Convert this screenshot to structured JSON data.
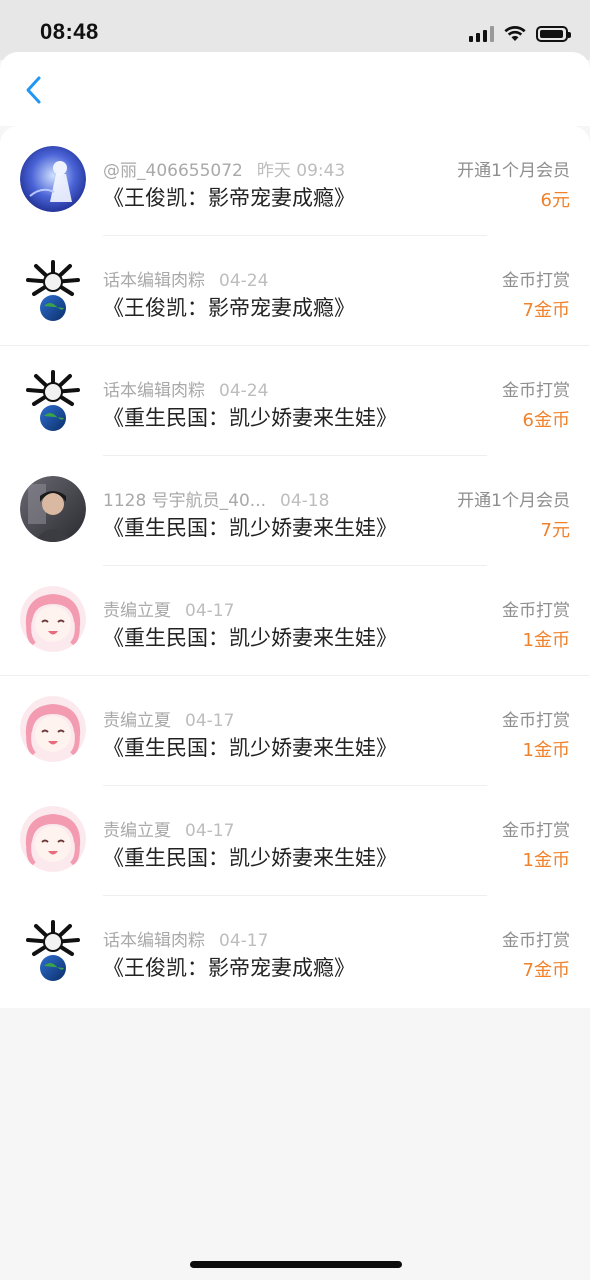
{
  "status_bar": {
    "time": "08:48"
  },
  "nav": {
    "back_icon": "chevron-left-icon"
  },
  "list": [
    {
      "user": "@丽_406655072",
      "date": "昨天 09:43",
      "title": "《王俊凯：影帝宠妻成瘾》",
      "type": "开通1个月会员",
      "amount": "6元",
      "avatar": "blue-figure"
    },
    {
      "user": "话本编辑肉粽",
      "date": "04-24",
      "title": "《王俊凯：影帝宠妻成瘾》",
      "type": "金币打赏",
      "amount": "7金币",
      "avatar": "globe-meme"
    },
    {
      "user": "话本编辑肉粽",
      "date": "04-24",
      "title": "《重生民国：凯少娇妻来生娃》",
      "type": "金币打赏",
      "amount": "6金币",
      "avatar": "globe-meme"
    },
    {
      "user": "1128 号宇航员_40...",
      "date": "04-18",
      "title": "《重生民国：凯少娇妻来生娃》",
      "type": "开通1个月会员",
      "amount": "7元",
      "avatar": "photo-portrait"
    },
    {
      "user": "责编立夏",
      "date": "04-17",
      "title": "《重生民国：凯少娇妻来生娃》",
      "type": "金币打赏",
      "amount": "1金币",
      "avatar": "anime-girl"
    },
    {
      "user": "责编立夏",
      "date": "04-17",
      "title": "《重生民国：凯少娇妻来生娃》",
      "type": "金币打赏",
      "amount": "1金币",
      "avatar": "anime-girl"
    },
    {
      "user": "责编立夏",
      "date": "04-17",
      "title": "《重生民国：凯少娇妻来生娃》",
      "type": "金币打赏",
      "amount": "1金币",
      "avatar": "anime-girl"
    },
    {
      "user": "话本编辑肉粽",
      "date": "04-17",
      "title": "《王俊凯：影帝宠妻成瘾》",
      "type": "金币打赏",
      "amount": "7金币",
      "avatar": "globe-meme"
    }
  ],
  "colors": {
    "accent": "#2196f3",
    "amount": "#f0822c",
    "meta": "#a9a9a9"
  }
}
